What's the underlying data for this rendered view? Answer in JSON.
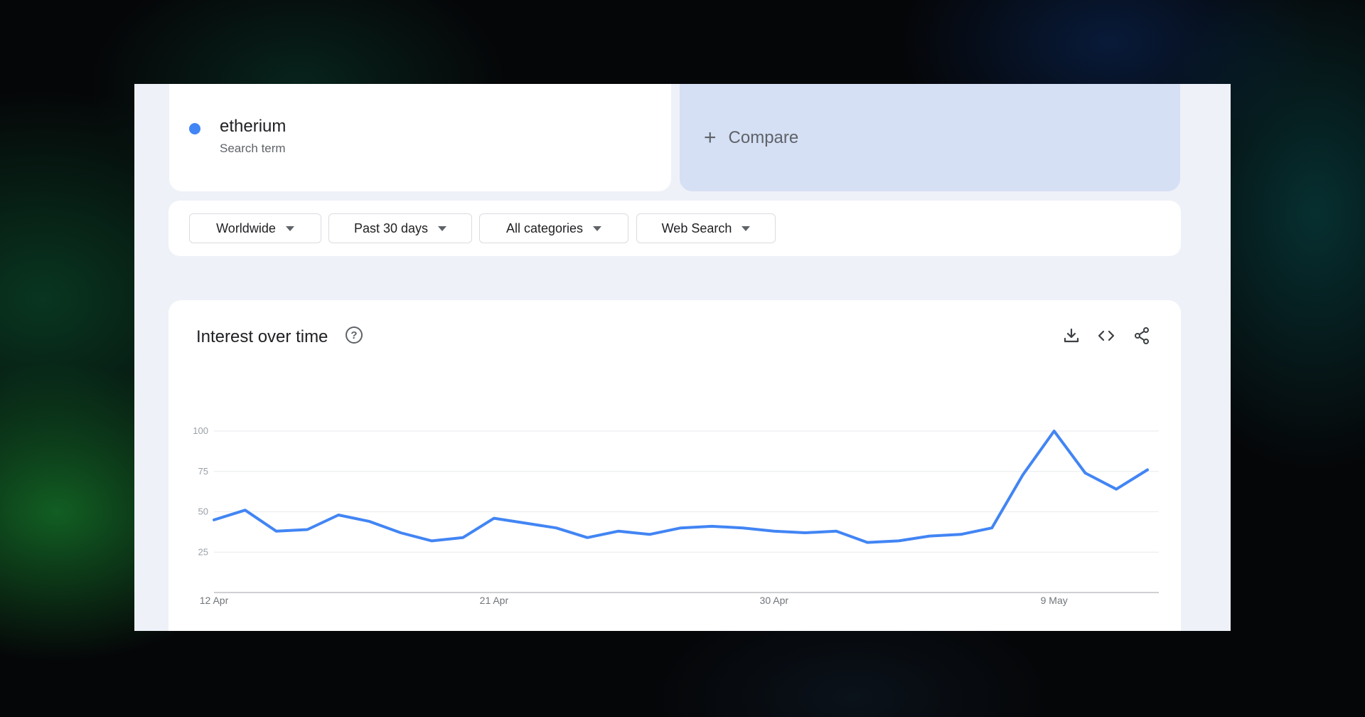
{
  "search_term": {
    "name": "etherium",
    "subtitle": "Search term",
    "color": "#4285f4"
  },
  "compare": {
    "plus": "+",
    "label": "Compare"
  },
  "filters": [
    {
      "label": "Worldwide"
    },
    {
      "label": "Past 30 days"
    },
    {
      "label": "All categories"
    },
    {
      "label": "Web Search"
    }
  ],
  "widget": {
    "title": "Interest over time",
    "help_icon": "?",
    "tools": [
      "download-icon",
      "embed-code-icon",
      "share-icon"
    ]
  },
  "chart_data": {
    "type": "line",
    "title": "Interest over time",
    "x_ticks": [
      "12 Apr",
      "21 Apr",
      "30 Apr",
      "9 May"
    ],
    "y_ticks": [
      25,
      50,
      75,
      100
    ],
    "ylim": [
      0,
      100
    ],
    "grid": true,
    "line_color": "#4285f4",
    "x": [
      "12 Apr",
      "13 Apr",
      "14 Apr",
      "15 Apr",
      "16 Apr",
      "17 Apr",
      "18 Apr",
      "19 Apr",
      "20 Apr",
      "21 Apr",
      "22 Apr",
      "23 Apr",
      "24 Apr",
      "25 Apr",
      "26 Apr",
      "27 Apr",
      "28 Apr",
      "29 Apr",
      "30 Apr",
      "1 May",
      "2 May",
      "3 May",
      "4 May",
      "5 May",
      "6 May",
      "7 May",
      "8 May",
      "9 May",
      "10 May",
      "11 May",
      "12 May"
    ],
    "series": [
      {
        "values": [
          45,
          51,
          38,
          39,
          48,
          44,
          37,
          32,
          34,
          46,
          43,
          40,
          34,
          38,
          36,
          40,
          41,
          40,
          38,
          37,
          38,
          31,
          32,
          35,
          36,
          40,
          73,
          100,
          74,
          64,
          76
        ]
      }
    ]
  }
}
